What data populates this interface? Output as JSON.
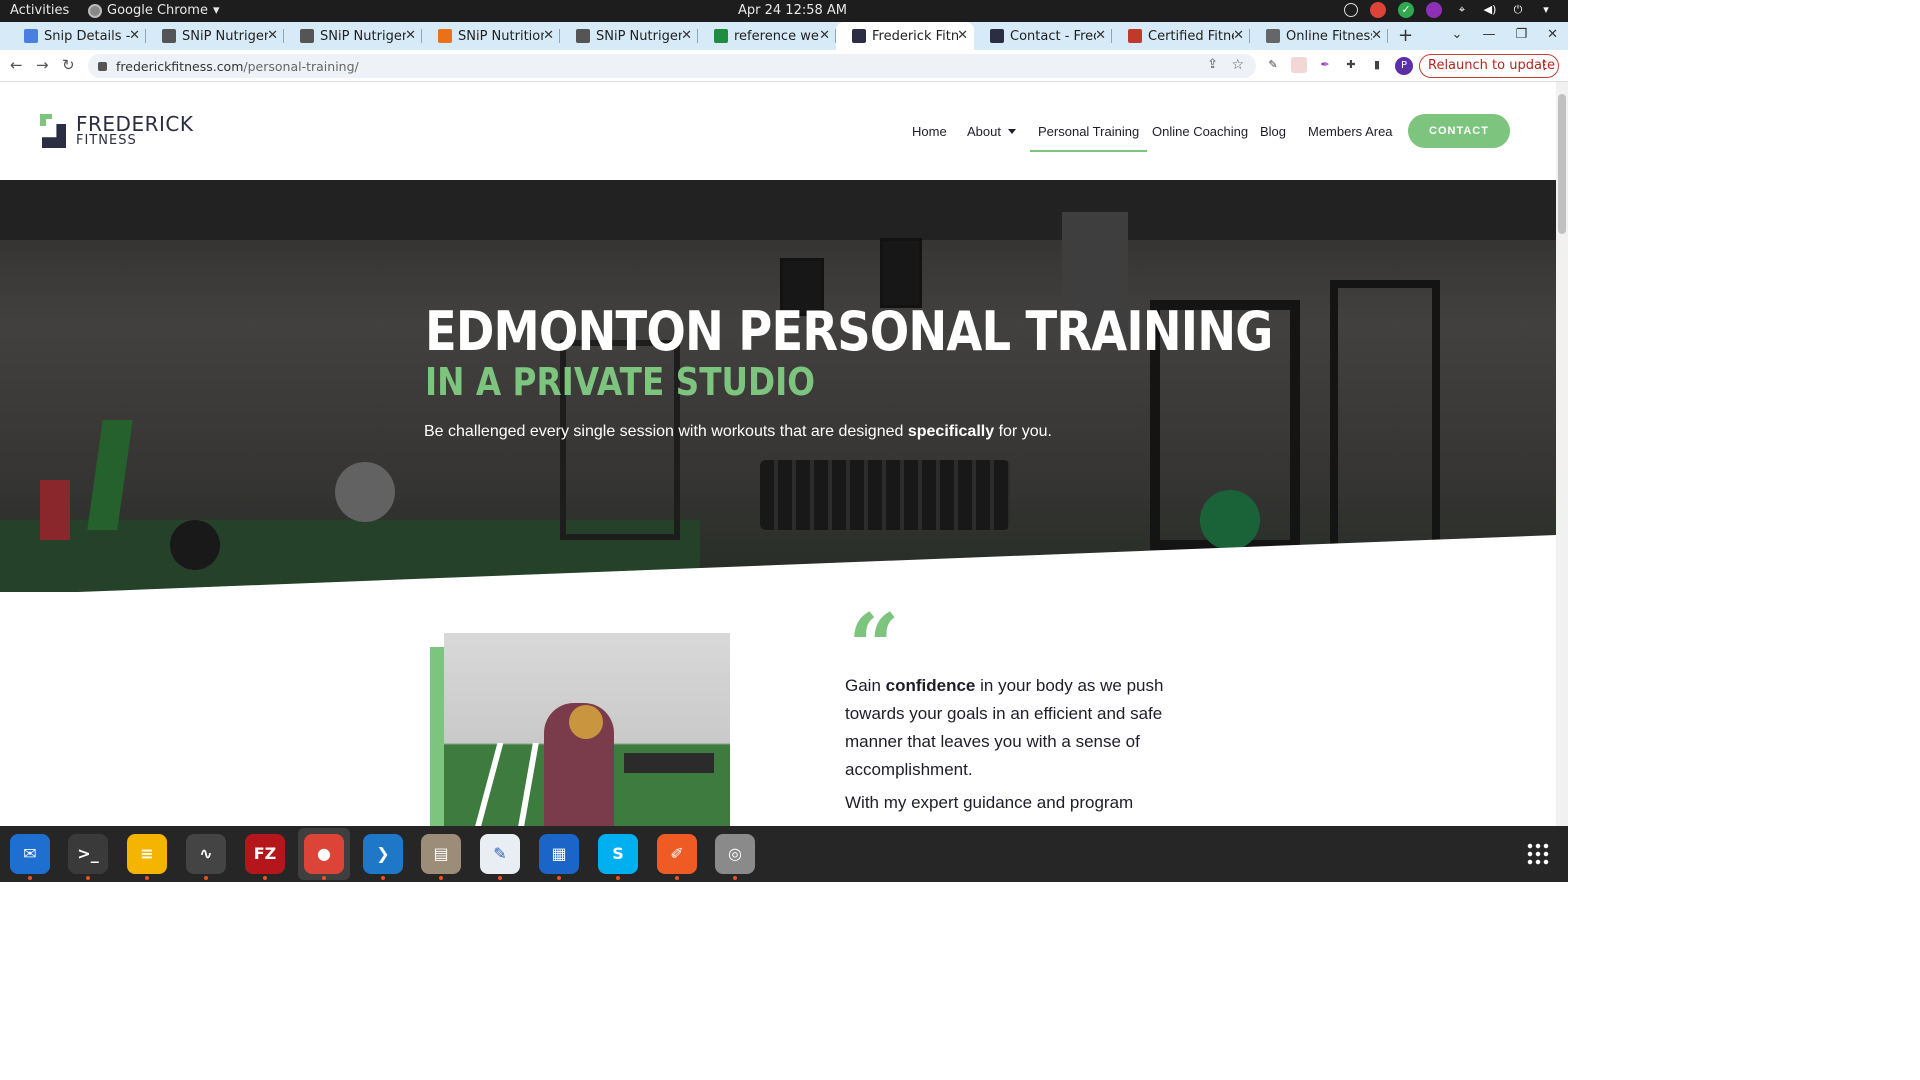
{
  "system": {
    "activities": "Activities",
    "app_name": "Google Chrome",
    "clock": "Apr 24  12:58 AM"
  },
  "tabs": [
    {
      "title": "Snip Details - G",
      "favicon_color": "#4a7ee0",
      "icon": "doc-icon"
    },
    {
      "title": "SNiP Nutrigeno",
      "favicon_color": "#555555",
      "icon": "snip-icon"
    },
    {
      "title": "SNiP Nutrigeno",
      "favicon_color": "#555555",
      "icon": "snip-icon"
    },
    {
      "title": "SNiP Nutrition",
      "favicon_color": "#e8711a",
      "icon": "snip-orange-icon"
    },
    {
      "title": "SNiP Nutrigeno",
      "favicon_color": "#555555",
      "icon": "snip-icon"
    },
    {
      "title": "reference webs",
      "favicon_color": "#1e8e3e",
      "icon": "sheets-icon"
    },
    {
      "title": "Frederick Fitne",
      "favicon_color": "#2b2d42",
      "icon": "frederick-icon",
      "active": true
    },
    {
      "title": "Contact - Frede",
      "favicon_color": "#2b2d42",
      "icon": "frederick-icon"
    },
    {
      "title": "Certified Fitnes",
      "favicon_color": "#c0392b",
      "icon": "cert-icon"
    },
    {
      "title": "Online Fitness",
      "favicon_color": "#666666",
      "icon": "globe-icon"
    }
  ],
  "address": {
    "domain": "frederickfitness.com",
    "path": "/personal-training/"
  },
  "relaunch_label": "Relaunch to update",
  "profile_initial": "P",
  "site": {
    "logo_line1": "FREDERICK",
    "logo_line2": "FITNESS",
    "nav": {
      "home": "Home",
      "about": "About",
      "personal_training": "Personal Training",
      "online_coaching": "Online Coaching",
      "blog": "Blog",
      "members": "Members Area",
      "contact": "CONTACT"
    },
    "hero": {
      "title": "EDMONTON PERSONAL TRAINING",
      "subtitle": "IN A PRIVATE STUDIO",
      "text_a": "Be challenged every single session with workouts that are designed ",
      "text_b": "specifically",
      "text_c": " for you."
    },
    "quote_mark": "“",
    "para1_a": "Gain ",
    "para1_b": "confidence",
    "para1_c": " in your body as we push towards your goals in an efficient and safe manner that leaves you with a sense of accomplishment.",
    "para2": "With my expert guidance and program"
  },
  "colors": {
    "brand_green": "#7dc47f",
    "brand_navy": "#2b2d42"
  },
  "dock": [
    {
      "name": "thunderbird",
      "color": "#1f6fd1",
      "glyph": "✉"
    },
    {
      "name": "terminal",
      "color": "#3a3a3a",
      "glyph": ">_"
    },
    {
      "name": "notes",
      "color": "#f5b400",
      "glyph": "≡"
    },
    {
      "name": "system-monitor",
      "color": "#444444",
      "glyph": "∿"
    },
    {
      "name": "filezilla",
      "color": "#b5161b",
      "glyph": "FZ"
    },
    {
      "name": "chrome",
      "color": "#db4437",
      "glyph": "●"
    },
    {
      "name": "vscode",
      "color": "#1e77c7",
      "glyph": "❯"
    },
    {
      "name": "files",
      "color": "#9b8d77",
      "glyph": "▤"
    },
    {
      "name": "text-editor",
      "color": "#e9eef5",
      "glyph": "✎"
    },
    {
      "name": "document-viewer",
      "color": "#1b64c8",
      "glyph": "▦"
    },
    {
      "name": "skype",
      "color": "#00aff0",
      "glyph": "S"
    },
    {
      "name": "postman",
      "color": "#ef5b25",
      "glyph": "✐"
    },
    {
      "name": "disk-utility",
      "color": "#8a8a8a",
      "glyph": "◎"
    }
  ]
}
